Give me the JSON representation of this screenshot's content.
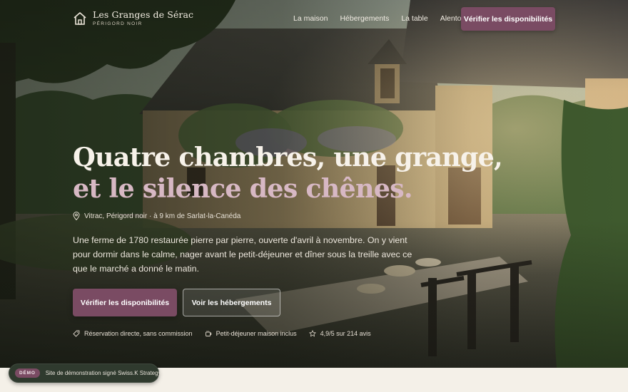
{
  "brand": {
    "name": "Les Granges de Sérac",
    "subtitle": "PÉRIGORD NOIR",
    "icon": "house-outline-icon"
  },
  "nav": {
    "items": [
      {
        "label": "La maison"
      },
      {
        "label": "Hébergements"
      },
      {
        "label": "La table"
      },
      {
        "label": "Alentours"
      }
    ],
    "cta_label": "Vérifier les disponibilités"
  },
  "hero": {
    "headline_line1": "Quatre chambres, une grange,",
    "headline_line2": "et le silence des chênes.",
    "location": "Vitrac, Périgord noir · à 9 km de Sarlat-la-Canéda",
    "location_icon": "map-pin-icon",
    "intro": "Une ferme de 1780 restaurée pierre par pierre, ouverte d'avril à novembre. On y vient pour dormir dans le calme, nager avant le petit-déjeuner et dîner sous la treille avec ce que le marché a donné le matin.",
    "primary_button": "Vérifier les disponibilités",
    "secondary_button": "Voir les hébergements",
    "perks": [
      {
        "icon": "tag-icon",
        "label": "Réservation directe, sans commission"
      },
      {
        "icon": "coffee-cup-icon",
        "label": "Petit-déjeuner maison inclus"
      },
      {
        "icon": "star-icon",
        "label": "4,9/5 sur 214 avis"
      }
    ]
  },
  "demo": {
    "badge": "DÉMO",
    "text": "Site de démonstration signé Swiss.K Strategy"
  },
  "colors": {
    "accent": "#7a4b63",
    "headline_accent": "#d7b8c4",
    "page_bg": "#f4f0e8"
  }
}
